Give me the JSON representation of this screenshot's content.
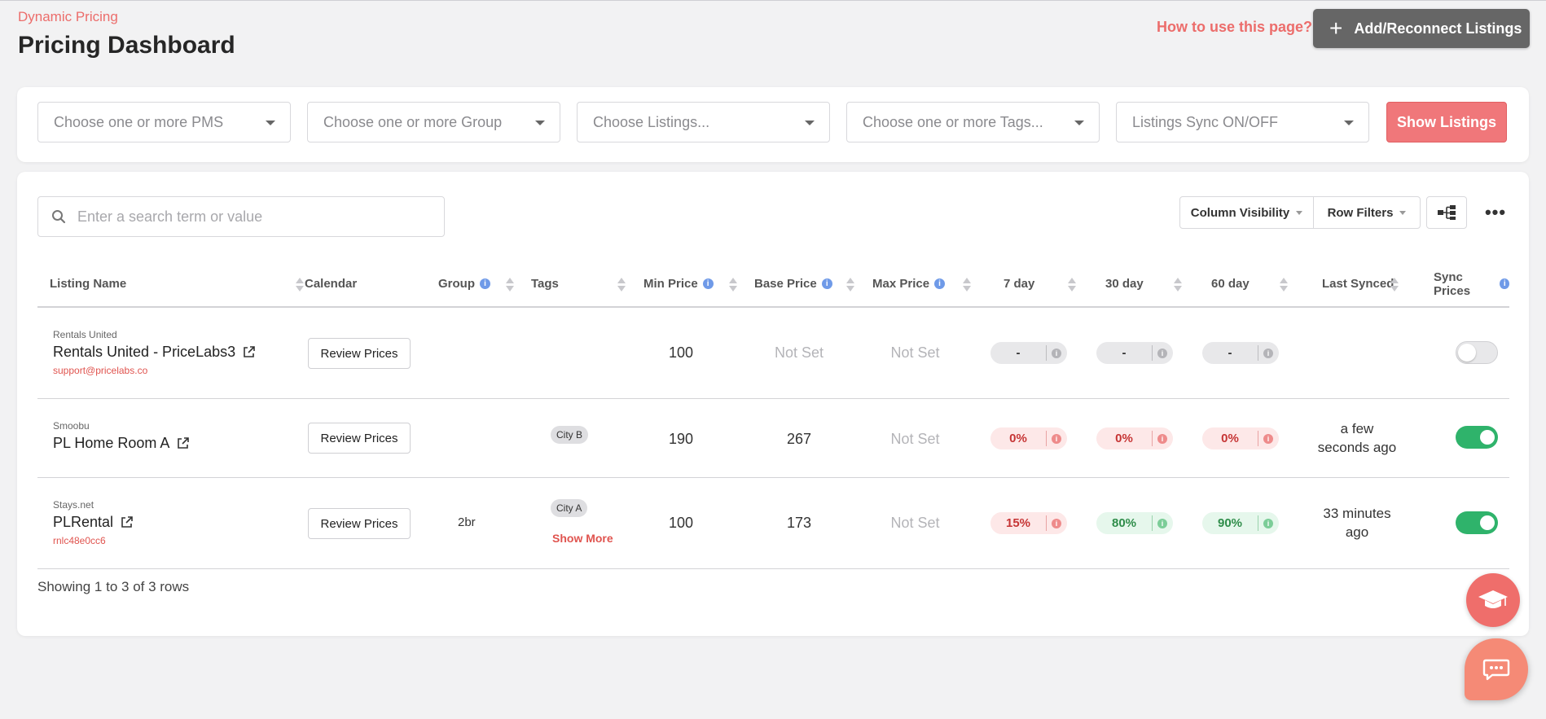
{
  "header": {
    "breadcrumb": "Dynamic Pricing",
    "title": "Pricing Dashboard",
    "help_link": "How to use this page?",
    "add_button": "Add/Reconnect Listings"
  },
  "filters": {
    "pms_placeholder": "Choose one or more PMS",
    "group_placeholder": "Choose one or more Group",
    "listings_placeholder": "Choose Listings...",
    "tags_placeholder": "Choose one or more Tags...",
    "sync_placeholder": "Listings Sync ON/OFF",
    "show_button": "Show Listings"
  },
  "toolbar": {
    "search_placeholder": "Enter a search term or value",
    "column_visibility": "Column Visibility",
    "row_filters": "Row Filters"
  },
  "columns": {
    "listing_name": "Listing Name",
    "calendar": "Calendar",
    "group": "Group",
    "tags": "Tags",
    "min_price": "Min Price",
    "base_price": "Base Price",
    "max_price": "Max Price",
    "day7": "7 day",
    "day30": "30 day",
    "day60": "60 day",
    "last_synced": "Last Synced",
    "sync_prices": "Sync Prices"
  },
  "rows": [
    {
      "pms": "Rentals United",
      "name": "Rentals United - PriceLabs3",
      "sub": "support@pricelabs.co",
      "calendar_button": "Review Prices",
      "group": "",
      "tags": [],
      "min_price": "100",
      "base_price": "Not Set",
      "max_price": "Not Set",
      "occ7": "-",
      "occ30": "-",
      "occ60": "-",
      "last_synced_1": "",
      "last_synced_2": "",
      "sync": false
    },
    {
      "pms": "Smoobu",
      "name": "PL Home Room A",
      "sub": "",
      "calendar_button": "Review Prices",
      "group": "",
      "tags": [
        "City B"
      ],
      "min_price": "190",
      "base_price": "267",
      "max_price": "Not Set",
      "occ7": "0%",
      "occ30": "0%",
      "occ60": "0%",
      "last_synced_1": "a few",
      "last_synced_2": "seconds ago",
      "sync": true
    },
    {
      "pms": "Stays.net",
      "name": "PLRental",
      "sub": "rnlc48e0cc6",
      "calendar_button": "Review Prices",
      "group": "2br",
      "tags": [
        "City A"
      ],
      "show_more": "Show More",
      "min_price": "100",
      "base_price": "173",
      "max_price": "Not Set",
      "occ7": "15%",
      "occ30": "80%",
      "occ60": "90%",
      "last_synced_1": "33 minutes",
      "last_synced_2": "ago",
      "sync": true
    }
  ],
  "footer": {
    "showing": "Showing 1 to 3 of 3 rows"
  },
  "colors": {
    "accent": "#ec6d6b",
    "toggle_on": "#2fb36b",
    "info": "#6f9ae8"
  },
  "icons": [
    "plus-icon",
    "caret-down-icon",
    "search-icon",
    "tree-icon",
    "more-icon",
    "external-link-icon",
    "info-icon",
    "graduation-cap-icon",
    "chat-icon"
  ]
}
